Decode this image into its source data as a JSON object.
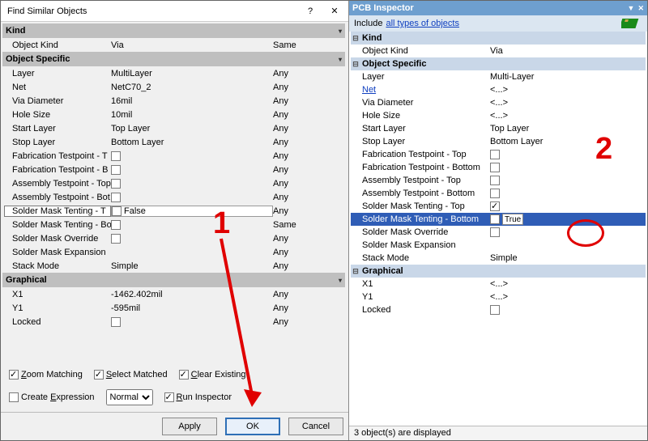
{
  "dialog": {
    "title": "Find Similar Objects",
    "sections": {
      "kind": {
        "label": "Kind",
        "rows": [
          {
            "name": "Object Kind",
            "value": "Via",
            "scope": "Same"
          }
        ]
      },
      "objectSpecific": {
        "label": "Object Specific",
        "rows": [
          {
            "name": "Layer",
            "value": "MultiLayer",
            "scope": "Any"
          },
          {
            "name": "Net",
            "value": "NetC70_2",
            "scope": "Any"
          },
          {
            "name": "Via Diameter",
            "value": "16mil",
            "scope": "Any"
          },
          {
            "name": "Hole Size",
            "value": "10mil",
            "scope": "Any"
          },
          {
            "name": "Start Layer",
            "value": "Top Layer",
            "scope": "Any"
          },
          {
            "name": "Stop Layer",
            "value": "Bottom Layer",
            "scope": "Any"
          },
          {
            "name": "Fabrication Testpoint - T",
            "check": false,
            "scope": "Any"
          },
          {
            "name": "Fabrication Testpoint - B",
            "check": false,
            "scope": "Any"
          },
          {
            "name": "Assembly Testpoint - Top",
            "check": false,
            "scope": "Any"
          },
          {
            "name": "Assembly Testpoint - Bot",
            "check": false,
            "scope": "Any"
          },
          {
            "name": "Solder Mask Tenting - T",
            "check": false,
            "valueText": "False",
            "scope": "Any",
            "selected": true
          },
          {
            "name": "Solder Mask Tenting - Bo",
            "check": false,
            "scope": "Same"
          },
          {
            "name": "Solder Mask Override",
            "check": false,
            "scope": "Any"
          },
          {
            "name": "Solder Mask Expansion",
            "value": "",
            "scope": "Any"
          },
          {
            "name": "Stack Mode",
            "value": "Simple",
            "scope": "Any"
          }
        ]
      },
      "graphical": {
        "label": "Graphical",
        "rows": [
          {
            "name": "X1",
            "value": "-1462.402mil",
            "scope": "Any"
          },
          {
            "name": "Y1",
            "value": "-595mil",
            "scope": "Any"
          },
          {
            "name": "Locked",
            "check": false,
            "scope": "Any"
          }
        ]
      }
    },
    "options": {
      "zoomMatching": {
        "label": "Zoom Matching",
        "checked": true,
        "ul": "Z"
      },
      "selectMatched": {
        "label": "Select Matched",
        "checked": true,
        "ul": "S"
      },
      "clearExisting": {
        "label": "Clear Existing",
        "checked": true,
        "ul": "C"
      },
      "createExpression": {
        "label": "Create Expression",
        "checked": false,
        "ul": "E"
      },
      "runInspector": {
        "label": "Run Inspector",
        "checked": true,
        "ul": "R"
      },
      "maskDropdown": "Normal"
    },
    "buttons": {
      "apply": "Apply",
      "ok": "OK",
      "cancel": "Cancel"
    }
  },
  "inspector": {
    "title": "PCB Inspector",
    "includeLabel": "Include",
    "includeLink": "all types of objects",
    "sections": [
      {
        "label": "Kind",
        "rows": [
          {
            "name": "Object Kind",
            "value": "Via"
          }
        ]
      },
      {
        "label": "Object Specific",
        "rows": [
          {
            "name": "Layer",
            "value": "Multi-Layer"
          },
          {
            "name": "Net",
            "value": "<...>",
            "link": true
          },
          {
            "name": "Via Diameter",
            "value": "<...>"
          },
          {
            "name": "Hole Size",
            "value": "<...>"
          },
          {
            "name": "Start Layer",
            "value": "Top Layer"
          },
          {
            "name": "Stop Layer",
            "value": "Bottom Layer"
          },
          {
            "name": "Fabrication Testpoint - Top",
            "check": false
          },
          {
            "name": "Fabrication Testpoint - Bottom",
            "check": false
          },
          {
            "name": "Assembly Testpoint - Top",
            "check": false
          },
          {
            "name": "Assembly Testpoint - Bottom",
            "check": false
          },
          {
            "name": "Solder Mask Tenting - Top",
            "check": true
          },
          {
            "name": "Solder Mask Tenting - Bottom",
            "check": true,
            "valueText": "True",
            "selected": true
          },
          {
            "name": "Solder Mask Override",
            "check": false
          },
          {
            "name": "Solder Mask Expansion",
            "value": ""
          },
          {
            "name": "Stack Mode",
            "value": "Simple"
          }
        ]
      },
      {
        "label": "Graphical",
        "rows": [
          {
            "name": "X1",
            "value": "<...>"
          },
          {
            "name": "Y1",
            "value": "<...>"
          },
          {
            "name": "Locked",
            "check": false
          }
        ]
      }
    ],
    "status": "3 object(s) are displayed"
  },
  "annotations": {
    "one": "1",
    "two": "2"
  }
}
